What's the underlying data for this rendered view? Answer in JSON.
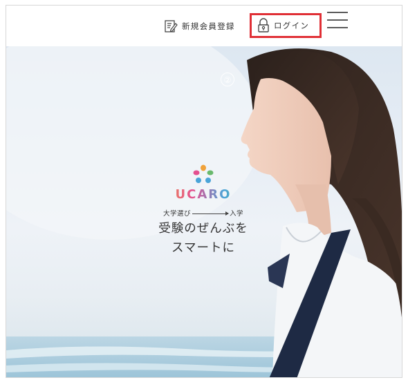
{
  "header": {
    "register_label": "新規会員登録",
    "login_label": "ログイン",
    "icons": {
      "register": "register-doc-icon",
      "login": "padlock-icon",
      "menu": "hamburger-menu-icon"
    },
    "highlight_color": "#e02f35"
  },
  "hero": {
    "badge": "②",
    "logo_text": "UCARO",
    "sub_left": "大学選び",
    "sub_right": "入学",
    "tagline_line1": "受験のぜんぶを",
    "tagline_line2": "スマートに",
    "logo_colors": [
      "#f0a23a",
      "#e4508f",
      "#4aa4d8",
      "#69b96d"
    ]
  }
}
